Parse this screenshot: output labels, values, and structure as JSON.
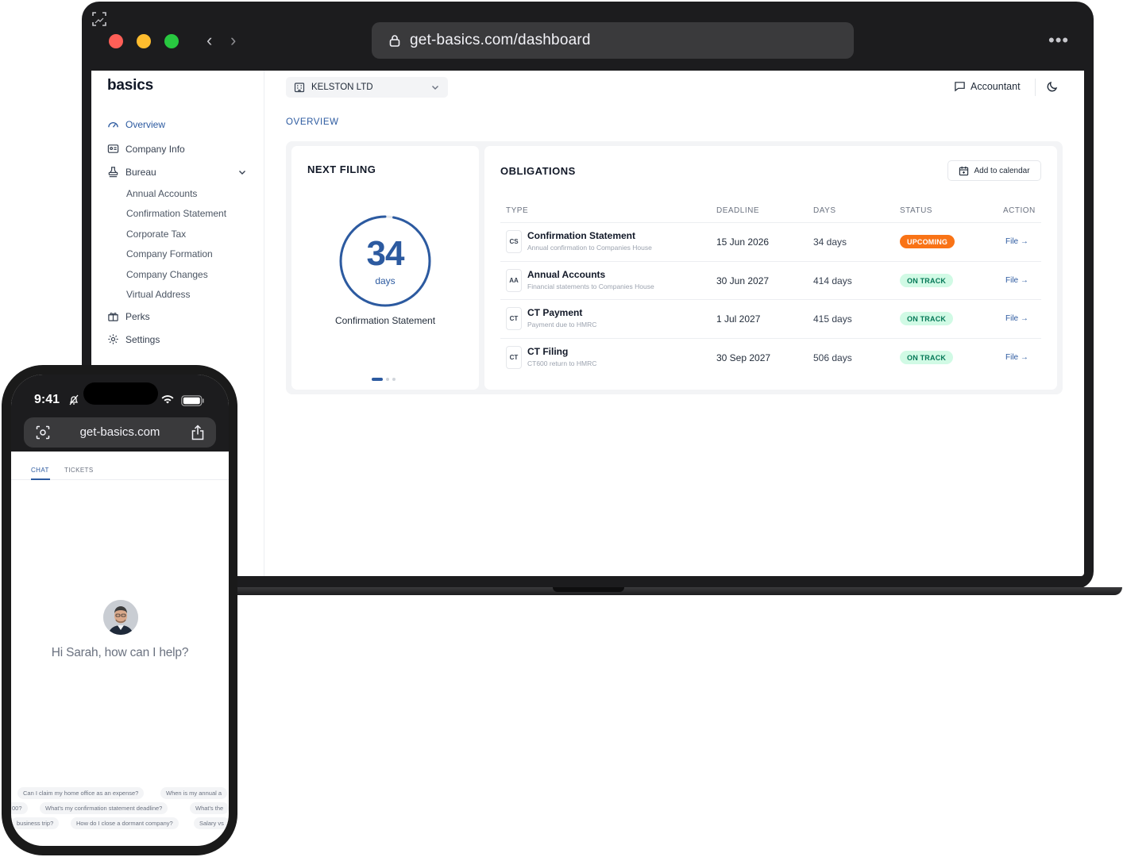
{
  "browser": {
    "url": "get-basics.com/dashboard"
  },
  "sidebar": {
    "brand": "basics",
    "items": [
      {
        "label": "Overview"
      },
      {
        "label": "Company Info"
      },
      {
        "label": "Bureau"
      },
      {
        "label": "Perks"
      },
      {
        "label": "Settings"
      }
    ],
    "bureau_sub": [
      {
        "label": "Annual Accounts"
      },
      {
        "label": "Confirmation Statement"
      },
      {
        "label": "Corporate Tax"
      },
      {
        "label": "Company Formation"
      },
      {
        "label": "Company Changes"
      },
      {
        "label": "Virtual Address"
      }
    ]
  },
  "header": {
    "company": "KELSTON LTD",
    "accountant_label": "Accountant"
  },
  "overview": {
    "section_label": "OVERVIEW",
    "next_filing": {
      "title": "NEXT FILING",
      "days_value": "34",
      "days_unit": "days",
      "caption": "Confirmation Statement",
      "progress_fraction": 0.97
    },
    "obligations": {
      "title": "OBLIGATIONS",
      "add_calendar": "Add to calendar",
      "columns": {
        "type": "TYPE",
        "deadline": "DEADLINE",
        "days": "DAYS",
        "status": "STATUS",
        "action": "ACTION"
      },
      "rows": [
        {
          "code": "CS",
          "title": "Confirmation Statement",
          "subtitle": "Annual confirmation to Companies House",
          "deadline": "15 Jun 2026",
          "days": "34 days",
          "status": "UPCOMING",
          "action": "File →"
        },
        {
          "code": "AA",
          "title": "Annual Accounts",
          "subtitle": "Financial statements to Companies House",
          "deadline": "30 Jun 2027",
          "days": "414 days",
          "status": "ON TRACK",
          "action": "File →"
        },
        {
          "code": "CT",
          "title": "CT Payment",
          "subtitle": "Payment due to HMRC",
          "deadline": "1 Jul 2027",
          "days": "415 days",
          "status": "ON TRACK",
          "action": "File →"
        },
        {
          "code": "CT",
          "title": "CT Filing",
          "subtitle": "CT600 return to HMRC",
          "deadline": "30 Sep 2027",
          "days": "506 days",
          "status": "ON TRACK",
          "action": "File →"
        }
      ]
    }
  },
  "phone": {
    "time": "9:41",
    "url": "get-basics.com",
    "tabs": [
      {
        "label": "CHAT"
      },
      {
        "label": "TICKETS"
      }
    ],
    "greeting": "Hi Sarah, how can I help?",
    "suggestions": [
      {
        "label": "Can I claim my home office as an expense?"
      },
      {
        "label": "When is my annual a"
      },
      {
        "label": "00?"
      },
      {
        "label": "What's my confirmation statement deadline?"
      },
      {
        "label": "What's the"
      },
      {
        "label": "business trip?"
      },
      {
        "label": "How do I close a dormant company?"
      },
      {
        "label": "Salary vs"
      }
    ]
  },
  "colors": {
    "accent": "#2c5aa0",
    "upcoming": "#f97316",
    "on_track_bg": "#d1fae5",
    "on_track_text": "#047857"
  }
}
